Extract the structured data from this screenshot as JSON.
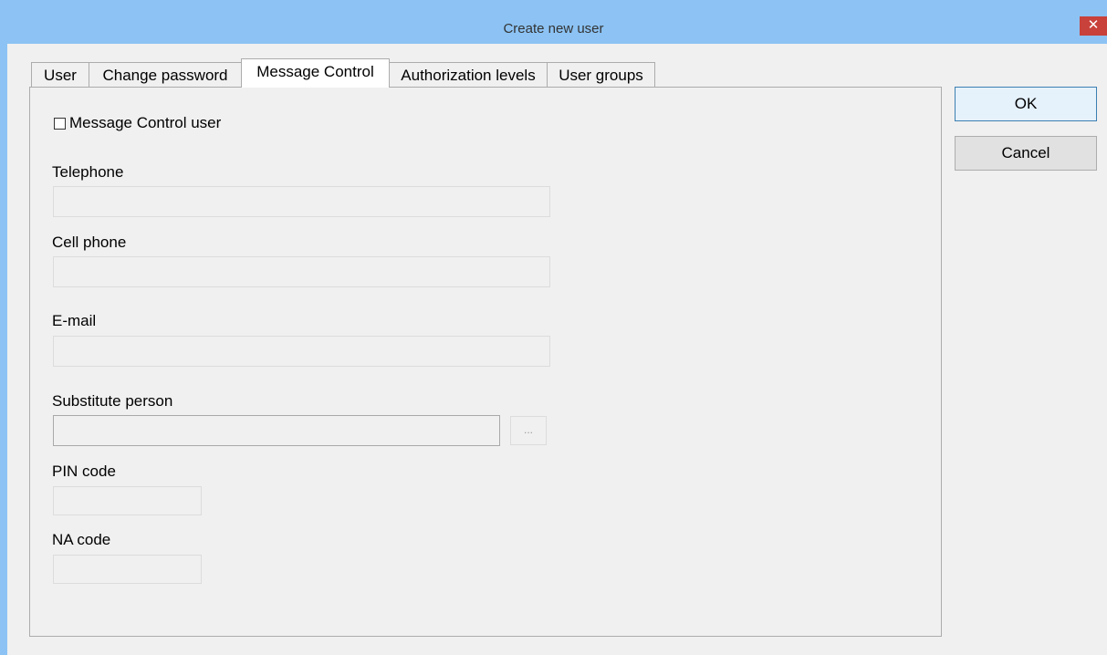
{
  "window": {
    "title": "Create new user",
    "close_glyph": "✕"
  },
  "tabs": [
    {
      "label": "User"
    },
    {
      "label": "Change password"
    },
    {
      "label": "Message Control",
      "active": true
    },
    {
      "label": "Authorization levels"
    },
    {
      "label": "User groups"
    }
  ],
  "form": {
    "message_control_user_label": "Message Control user",
    "message_control_user_checked": false,
    "telephone_label": "Telephone",
    "telephone_value": "",
    "cell_phone_label": "Cell phone",
    "cell_phone_value": "",
    "email_label": "E-mail",
    "email_value": "",
    "substitute_person_label": "Substitute person",
    "substitute_person_value": "",
    "browse_label": "...",
    "pin_code_label": "PIN code",
    "pin_code_value": "",
    "na_code_label": "NA code",
    "na_code_value": ""
  },
  "buttons": {
    "ok": "OK",
    "cancel": "Cancel"
  },
  "colors": {
    "titlebar": "#8cc3f4",
    "close": "#c8413a",
    "dialog": "#f0f0f0",
    "default_button_border": "#3c7fb1"
  },
  "icons": {
    "close": "close-icon",
    "checkbox": "checkbox-icon"
  }
}
